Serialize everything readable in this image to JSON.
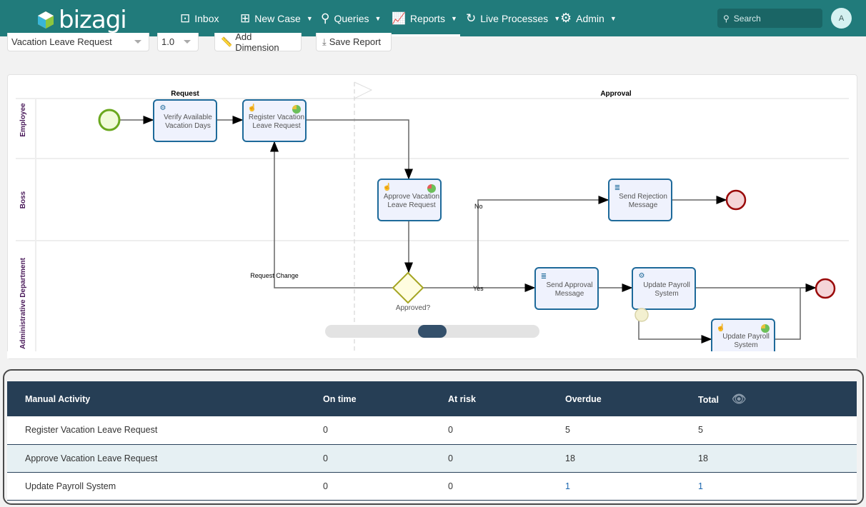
{
  "header": {
    "logo": "bizagi",
    "nav": [
      {
        "label": "Inbox",
        "icon": "inbox-icon"
      },
      {
        "label": "New Case",
        "icon": "new-case-icon"
      },
      {
        "label": "Queries",
        "icon": "search-icon"
      },
      {
        "label": "Reports",
        "icon": "reports-icon",
        "active": true
      },
      {
        "label": "Live Processes",
        "icon": "live-processes-icon"
      },
      {
        "label": "Admin",
        "icon": "gear-icon"
      }
    ],
    "search_placeholder": "Search",
    "avatar": "A",
    "brand_color": "#217b7b"
  },
  "toolbar": {
    "process": "Vacation Leave Request",
    "version": "1.0",
    "add_dimension": "Add Dimension",
    "save_report": "Save Report"
  },
  "diagram": {
    "phases": [
      "Request",
      "Approval"
    ],
    "lanes": [
      "Employee",
      "Boss",
      "Administrative Department"
    ],
    "tasks": {
      "verify": [
        "Verify Available",
        "Vacation Days"
      ],
      "register": [
        "Register Vacation",
        "Leave Request"
      ],
      "approve": [
        "Approve Vacation",
        "Leave Request"
      ],
      "reject": [
        "Send Rejection",
        "Message"
      ],
      "send_approval": [
        "Send Approval",
        "Message"
      ],
      "update1": [
        "Update Payroll",
        "System"
      ],
      "update2": [
        "Update Payroll",
        "System"
      ]
    },
    "gateway": "Approved?",
    "flow_labels": {
      "request_change": "Request Change",
      "no": "No",
      "yes": "Yes"
    }
  },
  "table": {
    "columns": [
      "Manual Activity",
      "On time",
      "At risk",
      "Overdue",
      "Total"
    ],
    "rows": [
      {
        "activity": "Register Vacation Leave Request",
        "on_time": "0",
        "at_risk": "0",
        "overdue": "5",
        "total": "5"
      },
      {
        "activity": "Approve Vacation Leave Request",
        "on_time": "0",
        "at_risk": "0",
        "overdue": "18",
        "total": "18"
      },
      {
        "activity": "Update Payroll System",
        "on_time": "0",
        "at_risk": "0",
        "overdue": "1",
        "total": "1"
      }
    ]
  }
}
